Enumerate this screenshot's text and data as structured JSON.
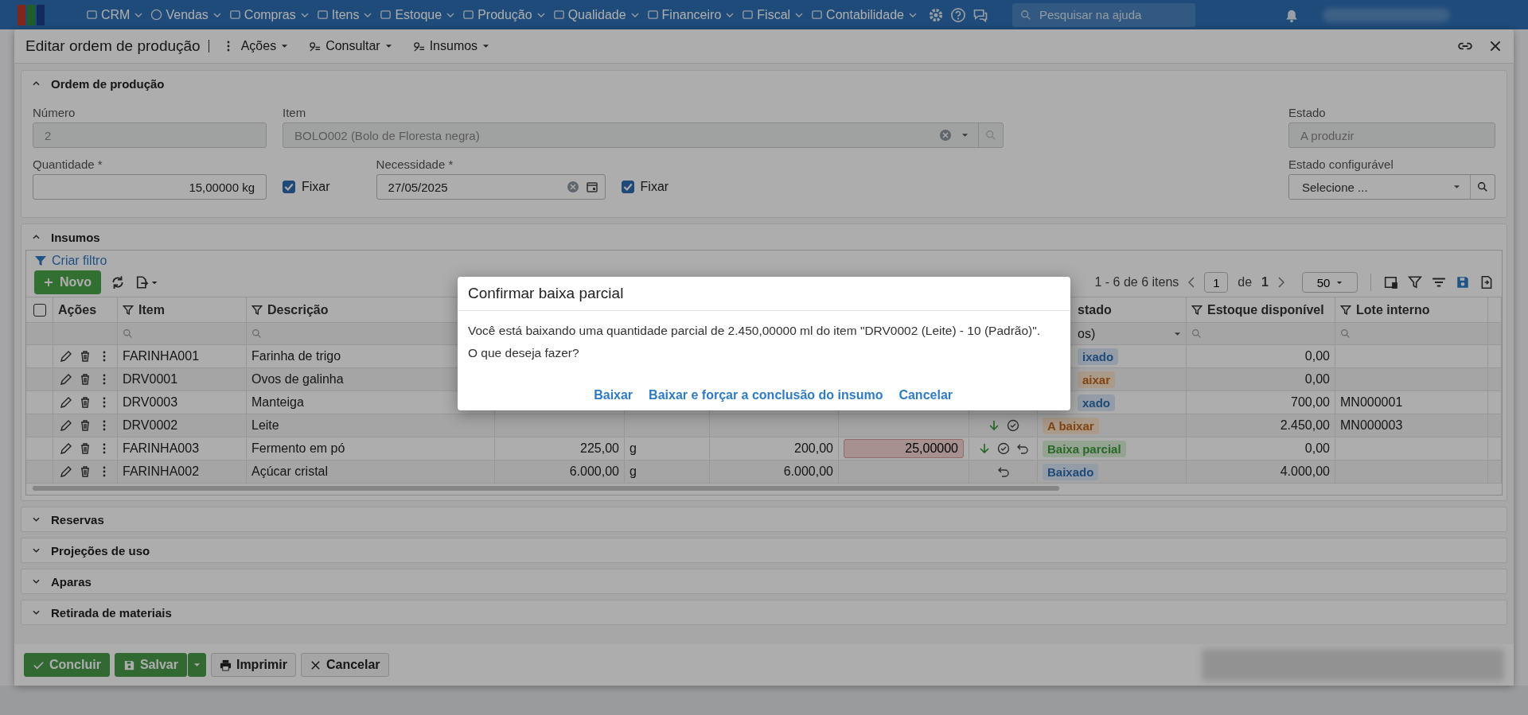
{
  "nav": {
    "items": [
      {
        "label": "CRM"
      },
      {
        "label": "Vendas"
      },
      {
        "label": "Compras"
      },
      {
        "label": "Itens"
      },
      {
        "label": "Estoque"
      },
      {
        "label": "Produção"
      },
      {
        "label": "Qualidade"
      },
      {
        "label": "Financeiro"
      },
      {
        "label": "Fiscal"
      },
      {
        "label": "Contabilidade"
      }
    ],
    "search": {
      "placeholder": "Pesquisar na ajuda"
    }
  },
  "window": {
    "title": "Editar ordem de produção",
    "menus": [
      {
        "label": "Ações"
      },
      {
        "label": "Consultar"
      },
      {
        "label": "Insumos"
      }
    ]
  },
  "order": {
    "title": "Ordem de produção",
    "expanded": true,
    "numero": {
      "label": "Número",
      "value": "2"
    },
    "item": {
      "label": "Item",
      "value": "BOLO002 (Bolo de Floresta negra)"
    },
    "estado": {
      "label": "Estado",
      "value": "A produzir"
    },
    "quantidade": {
      "label": "Quantidade *",
      "value": "15,00000 kg"
    },
    "fixar_quantidade": {
      "label": "Fixar",
      "checked": true
    },
    "necessidade": {
      "label": "Necessidade *",
      "value": "27/05/2025"
    },
    "fixar_necessidade": {
      "label": "Fixar",
      "checked": true
    },
    "estado_configuravel": {
      "label": "Estado configurável",
      "placeholder": "Selecione ..."
    }
  },
  "insumos": {
    "title": "Insumos",
    "expanded": true,
    "filter_link": "Criar filtro",
    "new_button": "Novo",
    "pager": {
      "summary": "1 - 6 de 6 itens",
      "page": "1",
      "of": "de",
      "total": "1",
      "page_size": "50"
    },
    "select_all": {
      "checked": false
    },
    "columns": [
      {
        "label": "Ações",
        "filter": false
      },
      {
        "label": "Item",
        "filter": true
      },
      {
        "label": "Descrição",
        "filter": true
      },
      {
        "label": "stado",
        "filter": false,
        "filter_value": "os)"
      },
      {
        "label": "Estoque disponível",
        "filter": true
      },
      {
        "label": "Lote interno",
        "filter": true
      }
    ],
    "rows": [
      {
        "item": "FARINHA001",
        "descricao": "Farinha de trigo",
        "status": {
          "text": "ixado",
          "kind": "done"
        },
        "estoque": "0,00"
      },
      {
        "item": "DRV0001",
        "descricao": "Ovos de galinha",
        "status": {
          "text": "aixar",
          "kind": "pending"
        },
        "estoque": "0,00"
      },
      {
        "item": "DRV0003",
        "descricao": "Manteiga",
        "status": {
          "text": "xado",
          "kind": "done"
        },
        "estoque": "700,00",
        "lote": "MN000001"
      },
      {
        "item": "DRV0002",
        "descricao": "Leite",
        "can_lower": true,
        "can_confirm": true,
        "status": {
          "text": "A baixar",
          "kind": "pending"
        },
        "estoque": "2.450,00",
        "lote": "MN000003"
      },
      {
        "item": "FARINHA003",
        "descricao": "Fermento em pó",
        "qty": "225,00",
        "unit": "g",
        "planned": "200,00",
        "input": {
          "value": "25,00000",
          "error": true
        },
        "can_lower": true,
        "can_confirm": true,
        "can_undo": true,
        "status": {
          "text": "Baixa parcial",
          "kind": "partial"
        },
        "estoque": "0,00"
      },
      {
        "item": "FARINHA002",
        "descricao": "Açúcar cristal",
        "qty": "6.000,00",
        "unit": "g",
        "planned": "6.000,00",
        "can_undo": true,
        "status": {
          "text": "Baixado",
          "kind": "done"
        },
        "estoque": "4.000,00"
      }
    ]
  },
  "collapsed_sections": [
    {
      "title": "Reservas",
      "expanded": false
    },
    {
      "title": "Projeções de uso",
      "expanded": false
    },
    {
      "title": "Aparas",
      "expanded": false
    },
    {
      "title": "Retirada de materiais",
      "expanded": false
    }
  ],
  "footer": {
    "buttons": [
      {
        "label": "Concluir",
        "kind": "success"
      },
      {
        "label": "Salvar",
        "kind": "success-split"
      },
      {
        "label": "Imprimir",
        "kind": "plain"
      },
      {
        "label": "Cancelar",
        "kind": "plain"
      }
    ]
  },
  "dialog": {
    "title": "Confirmar baixa parcial",
    "message": "Você está baixando uma quantidade parcial de 2.450,00000 ml do item \"DRV0002 (Leite) - 10 (Padrão)\".",
    "question": "O que deseja fazer?",
    "actions": [
      "Baixar",
      "Baixar e forçar a conclusão do insumo",
      "Cancelar"
    ]
  }
}
